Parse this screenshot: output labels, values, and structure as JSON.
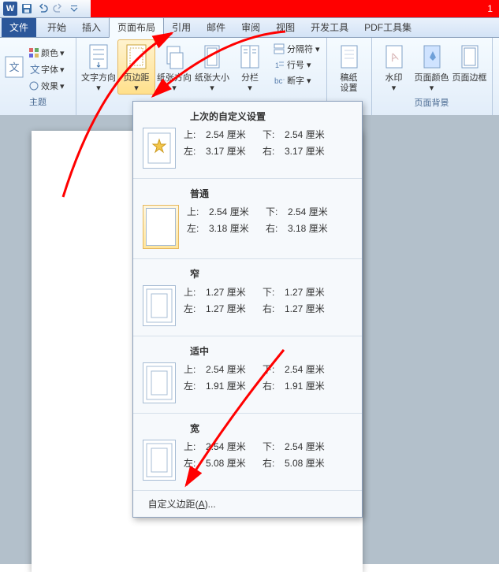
{
  "titlebar": {
    "indicator": "1"
  },
  "tabs": {
    "file": "文件",
    "items": [
      "开始",
      "插入",
      "页面布局",
      "引用",
      "邮件",
      "审阅",
      "视图",
      "开发工具",
      "PDF工具集"
    ],
    "activeIndex": 2
  },
  "ribbon": {
    "theme": {
      "label": "主题",
      "colors": "颜色",
      "fonts": "字体",
      "effects": "效果"
    },
    "pagesetup": {
      "textdir": "文字方向",
      "margins": "页边距",
      "orient": "纸张方向",
      "size": "纸张大小",
      "columns": "分栏",
      "breaks": "分隔符",
      "linenum": "行号",
      "hyphen": "断字"
    },
    "paper": {
      "label": "稿纸",
      "setting": "设置"
    },
    "pagebg": {
      "label": "页面背景",
      "watermark": "水印",
      "pagecolor": "页面颜色",
      "pageborder": "页面边框"
    }
  },
  "dropdown": {
    "sections": [
      {
        "title": "上次的自定义设置",
        "top": "2.54 厘米",
        "bottom": "2.54 厘米",
        "left": "3.17 厘米",
        "right": "3.17 厘米",
        "sel": false,
        "star": true
      },
      {
        "title": "普通",
        "top": "2.54 厘米",
        "bottom": "2.54 厘米",
        "left": "3.18 厘米",
        "right": "3.18 厘米",
        "sel": true
      },
      {
        "title": "窄",
        "top": "1.27 厘米",
        "bottom": "1.27 厘米",
        "left": "1.27 厘米",
        "right": "1.27 厘米",
        "sel": false
      },
      {
        "title": "适中",
        "top": "2.54 厘米",
        "bottom": "2.54 厘米",
        "left": "1.91 厘米",
        "right": "1.91 厘米",
        "sel": false
      },
      {
        "title": "宽",
        "top": "2.54 厘米",
        "bottom": "2.54 厘米",
        "left": "5.08 厘米",
        "right": "5.08 厘米",
        "sel": false
      }
    ],
    "labels": {
      "top": "上:",
      "bottom": "下:",
      "left": "左:",
      "right": "右:"
    },
    "custom": "自定义边距(A)..."
  }
}
